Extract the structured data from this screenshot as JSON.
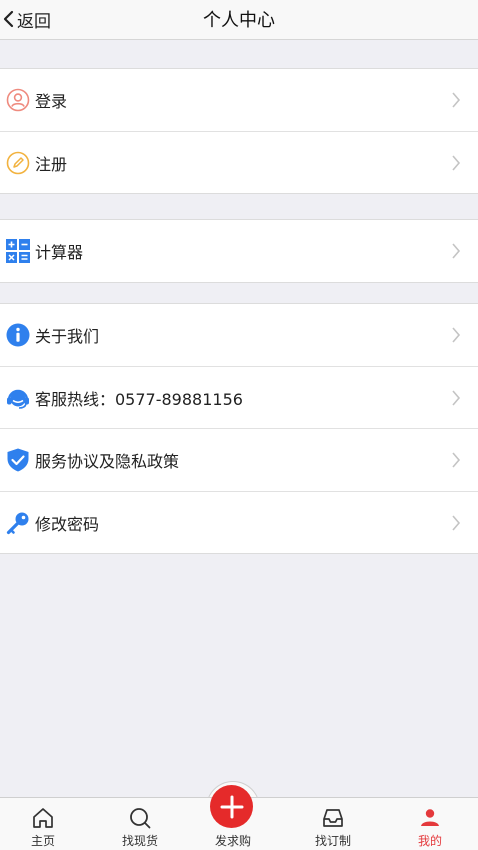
{
  "header": {
    "back_label": "返回",
    "title": "个人中心"
  },
  "groups": [
    {
      "items": [
        {
          "label": "登录",
          "icon": "user-circle-icon"
        },
        {
          "label": "注册",
          "icon": "pencil-circle-icon"
        }
      ]
    },
    {
      "items": [
        {
          "label": "计算器",
          "icon": "calculator-icon"
        }
      ]
    },
    {
      "items": [
        {
          "label": "关于我们",
          "icon": "info-icon"
        },
        {
          "label": "客服热线：0577-89881156",
          "icon": "headset-icon"
        },
        {
          "label": "服务协议及隐私政策",
          "icon": "shield-check-icon"
        },
        {
          "label": "修改密码",
          "icon": "key-icon"
        }
      ]
    }
  ],
  "tabbar": {
    "tabs": [
      {
        "label": "主页",
        "icon": "home-icon"
      },
      {
        "label": "找现货",
        "icon": "search-icon"
      },
      {
        "label": "发求购",
        "icon": "plus-icon"
      },
      {
        "label": "找订制",
        "icon": "inbox-icon"
      },
      {
        "label": "我的",
        "icon": "person-icon"
      }
    ],
    "active": "我的"
  },
  "colors": {
    "accent": "#e52a2a",
    "icon_blue": "#2f80ed",
    "background": "#efeff4"
  }
}
